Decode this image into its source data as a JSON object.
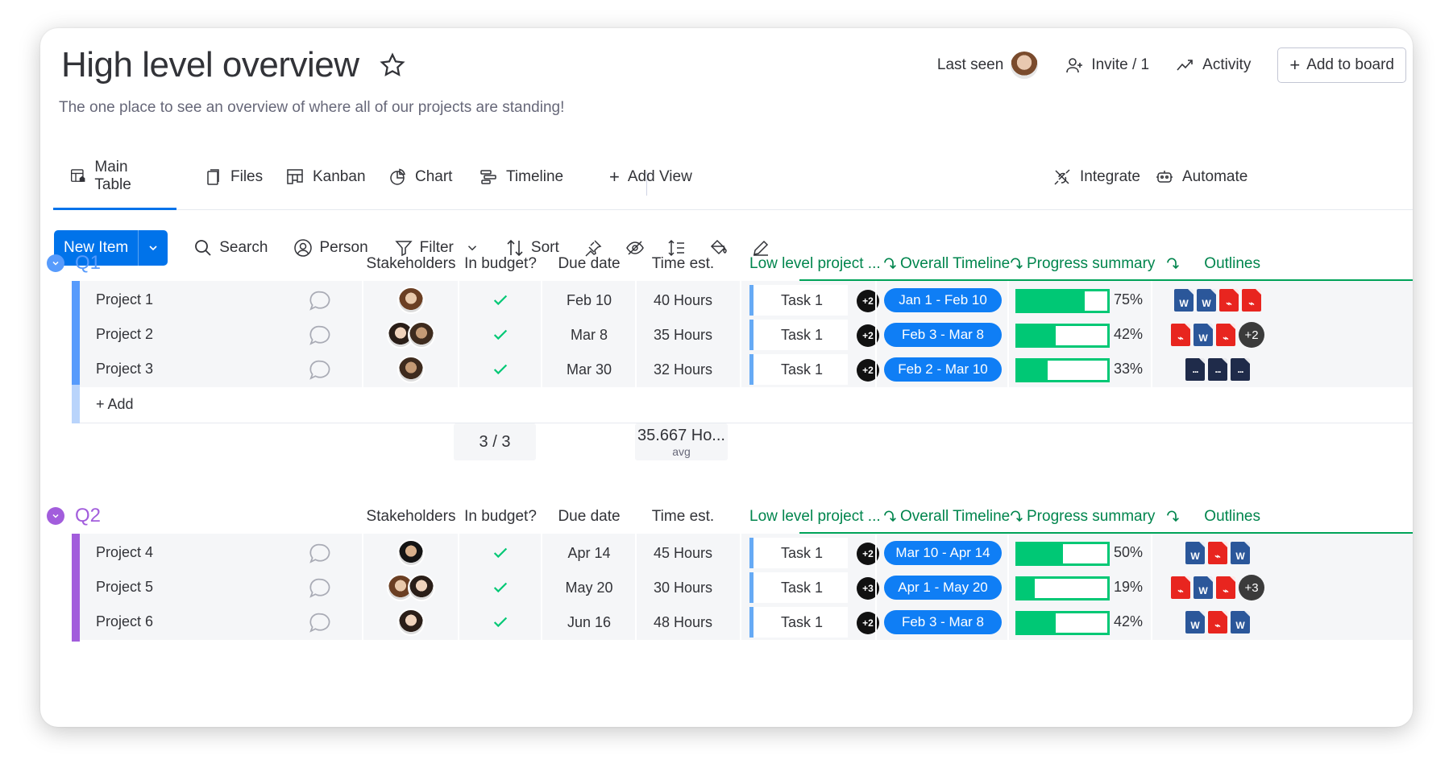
{
  "board": {
    "title": "High level overview",
    "subtitle": "The one place to see an overview of where all of our projects are standing!"
  },
  "header": {
    "last_seen": "Last seen",
    "invite": "Invite / 1",
    "activity": "Activity",
    "add_to_board": "Add to board"
  },
  "tabs": [
    {
      "label": "Main Table",
      "icon": "table-icon",
      "active": true
    },
    {
      "label": "Files",
      "icon": "files-icon"
    },
    {
      "label": "Kanban",
      "icon": "kanban-icon"
    },
    {
      "label": "Chart",
      "icon": "chart-icon"
    },
    {
      "label": "Timeline",
      "icon": "timeline-icon"
    },
    {
      "label": "Add View",
      "icon": "plus-icon"
    }
  ],
  "tabs_right": {
    "integrate": "Integrate",
    "automate": "Automate"
  },
  "toolbar": {
    "new_item": "New Item",
    "search": "Search",
    "person": "Person",
    "filter": "Filter",
    "sort": "Sort"
  },
  "columns": {
    "stakeholders": "Stakeholders",
    "in_budget": "In budget?",
    "due_date": "Due date",
    "time_est": "Time est.",
    "low_level": "Low level project ...",
    "overall_timeline": "Overall Timeline",
    "progress": "Progress summary",
    "outlines": "Outlines"
  },
  "colors": {
    "q1": "#579bfc",
    "q2": "#a25ddc",
    "primary": "#0073ea",
    "green": "#00c875",
    "timeline": "#0f7ef5"
  },
  "groups": [
    {
      "name": "Q1",
      "color": "#579bfc",
      "rows": [
        {
          "name": "Project 1",
          "due": "Feb 10",
          "time": "40 Hours",
          "task": "Task 1",
          "task_more": "+2",
          "timeline": "Jan 1 - Feb 10",
          "progress": 75,
          "progress_label": "75%",
          "files": [
            "word",
            "word",
            "pdf",
            "pdf"
          ],
          "files_more": ""
        },
        {
          "name": "Project 2",
          "due": "Mar 8",
          "time": "35 Hours",
          "task": "Task 1",
          "task_more": "+2",
          "timeline": "Feb 3 - Mar 8",
          "progress": 42,
          "progress_label": "42%",
          "files": [
            "pdf",
            "word",
            "pdf"
          ],
          "files_more": "+2"
        },
        {
          "name": "Project 3",
          "due": "Mar 30",
          "time": "32 Hours",
          "task": "Task 1",
          "task_more": "+2",
          "timeline": "Feb 2 - Mar 10",
          "progress": 33,
          "progress_label": "33%",
          "files": [
            "doc",
            "doc",
            "doc"
          ],
          "files_more": ""
        }
      ],
      "add_label": "+ Add",
      "summary_budget": "3 / 3",
      "summary_time": "35.667 Ho...",
      "summary_time_sub": "avg"
    },
    {
      "name": "Q2",
      "color": "#a25ddc",
      "rows": [
        {
          "name": "Project 4",
          "due": "Apr 14",
          "time": "45 Hours",
          "task": "Task 1",
          "task_more": "+2",
          "timeline": "Mar 10 - Apr 14",
          "progress": 50,
          "progress_label": "50%",
          "files": [
            "word",
            "pdf",
            "word"
          ],
          "files_more": ""
        },
        {
          "name": "Project 5",
          "due": "May 20",
          "time": "30 Hours",
          "task": "Task 1",
          "task_more": "+3",
          "timeline": "Apr 1 - May 20",
          "progress": 19,
          "progress_label": "19%",
          "files": [
            "pdf",
            "word",
            "pdf"
          ],
          "files_more": "+3"
        },
        {
          "name": "Project 6",
          "due": "Jun 16",
          "time": "48 Hours",
          "task": "Task 1",
          "task_more": "+2",
          "timeline": "Feb 3 - Mar 8",
          "progress": 42,
          "progress_label": "42%",
          "files": [
            "word",
            "pdf",
            "word"
          ],
          "files_more": ""
        }
      ]
    }
  ]
}
